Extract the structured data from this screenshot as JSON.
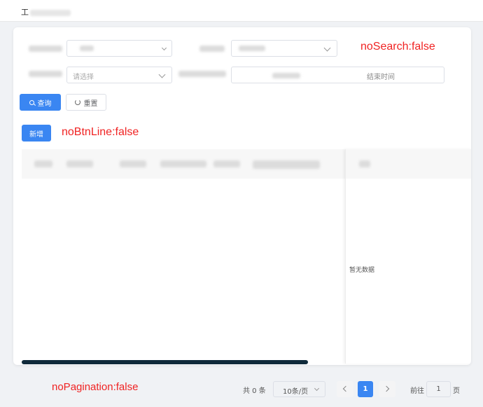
{
  "header": {
    "breadcrumb": "工"
  },
  "search": {
    "field1_value": "",
    "field2_value": "",
    "field3_value": "请选择",
    "date_end_placeholder": "结束时间",
    "search_button": "查询",
    "reset_button": "重置"
  },
  "annotations": {
    "no_search": "noSearch:false",
    "no_btn_line": "noBtnLine:false",
    "no_pagination": "noPagination:false"
  },
  "actions": {
    "add_button": "新增"
  },
  "table": {
    "empty_text": "暂无数据"
  },
  "pagination": {
    "total": "共 0 条",
    "page_size": "10条/页",
    "current_page": "1",
    "goto_label": "前往",
    "goto_value": "1",
    "page_suffix": "页"
  },
  "colors": {
    "primary": "#3a86f2",
    "annotation": "#f02323",
    "scrollbar": "#0f2a3a"
  }
}
